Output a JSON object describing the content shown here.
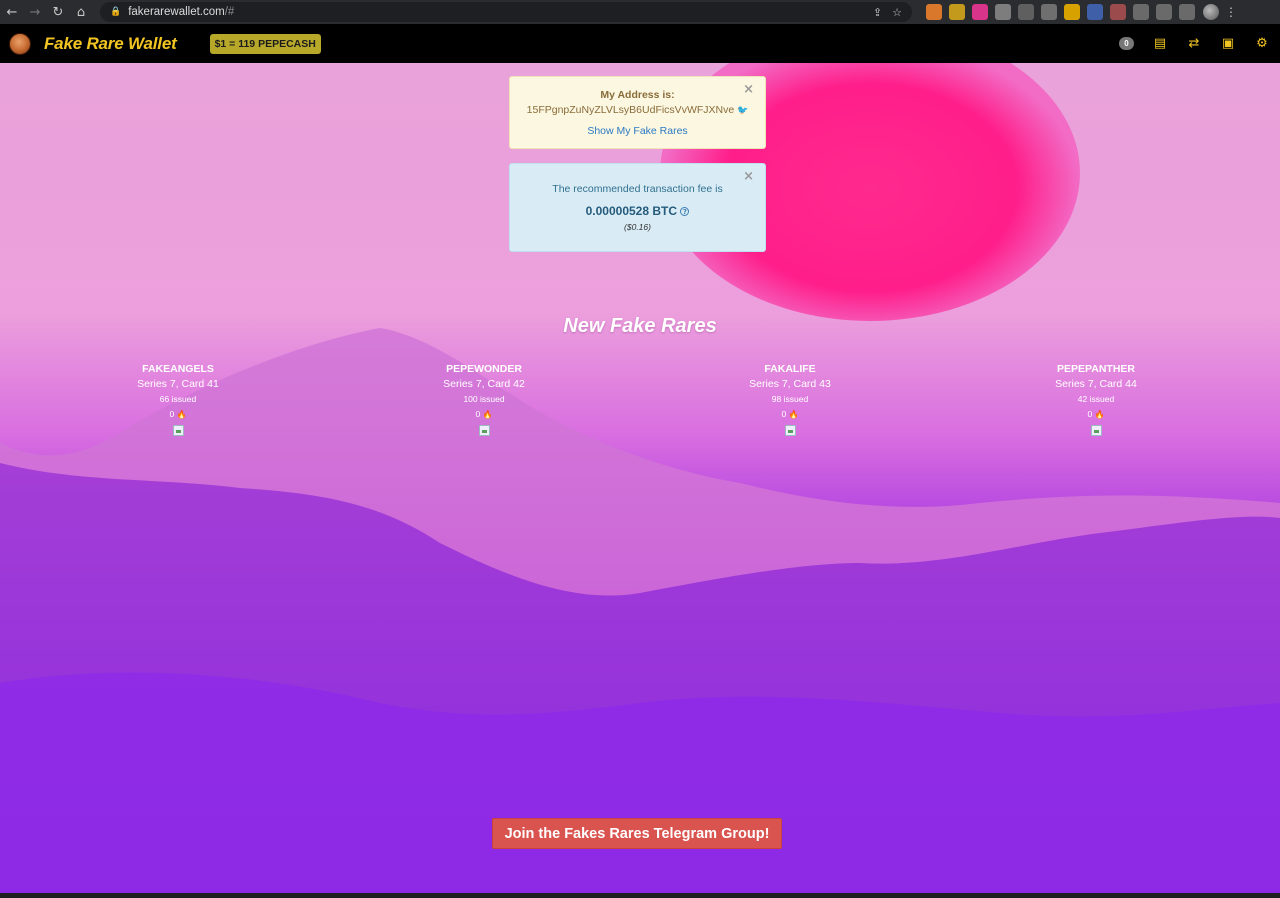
{
  "browser": {
    "url_host": "fakerarewallet.com",
    "url_path": "/#",
    "extensions": [
      {
        "icon": "metamask-fox-icon",
        "color": "#d9772a"
      },
      {
        "icon": "coin-icon",
        "color": "#c49a1c"
      },
      {
        "icon": "pink-square-icon",
        "color": "#d8358a"
      },
      {
        "icon": "chat-icon",
        "color": "#7d7d7d"
      },
      {
        "icon": "s-icon",
        "color": "#5f5f5f"
      },
      {
        "icon": "stack-icon",
        "color": "#6f6f6f"
      },
      {
        "icon": "hand-icon",
        "color": "#d7a200"
      },
      {
        "icon": "chart-icon",
        "color": "#3f5fa8"
      },
      {
        "icon": "ring-icon",
        "color": "#9b4b4b"
      },
      {
        "icon": "puzzle-icon",
        "color": "#6a6a6a"
      },
      {
        "icon": "queue-icon",
        "color": "#6a6a6a"
      },
      {
        "icon": "sidebar-icon",
        "color": "#6a6a6a"
      }
    ]
  },
  "navbar": {
    "brand": "Fake Rare Wallet",
    "rate": "$1 = 119 PEPECASH",
    "badge_count": "0",
    "icons": [
      "book-icon",
      "exchange-icon",
      "cash-icon",
      "settings-icon"
    ],
    "brand_color": "#f2c522"
  },
  "address_alert": {
    "title": "My Address is:",
    "address": "15FPgnpZuNyZLVLsyB6UdFicsVvWFJXNve",
    "link": "Show My Fake Rares"
  },
  "fee_alert": {
    "intro": "The recommended transaction fee is",
    "btc": "0.00000528 BTC",
    "usd": "($0.16)"
  },
  "section": {
    "title": "New Fake Rares"
  },
  "cards": [
    {
      "name": "FAKEANGELS",
      "series": "Series 7, Card 41",
      "issued": "66 issued",
      "likes": "0"
    },
    {
      "name": "PEPEWONDER",
      "series": "Series 7, Card 42",
      "issued": "100 issued",
      "likes": "0"
    },
    {
      "name": "FAKALIFE",
      "series": "Series 7, Card 43",
      "issued": "98 issued",
      "likes": "0"
    },
    {
      "name": "PEPEPANTHER",
      "series": "Series 7, Card 44",
      "issued": "42 issued",
      "likes": "0"
    }
  ],
  "telegram_button": "Join the Fakes Rares Telegram Group!"
}
